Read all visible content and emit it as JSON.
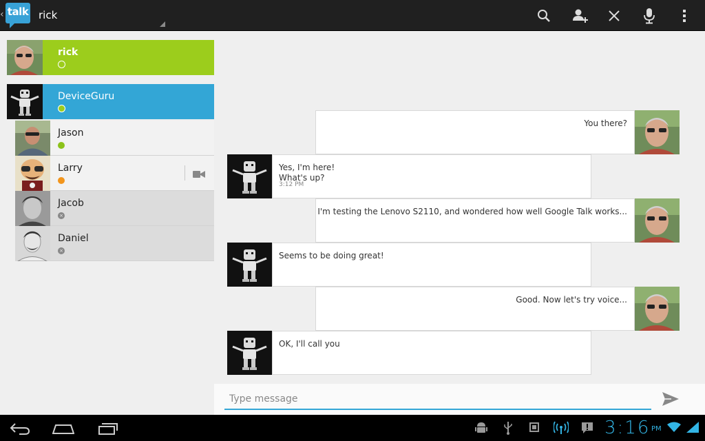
{
  "app": {
    "logo_text": "talk",
    "account": "rick"
  },
  "colors": {
    "accent_blue": "#33a6d6",
    "self_green": "#9ccd1c",
    "clock_blue": "#33b5e5"
  },
  "actionbar": {
    "icons": [
      "search-icon",
      "add-contact-icon",
      "close-icon",
      "microphone-icon",
      "overflow-menu-icon"
    ]
  },
  "me": {
    "name": "rick"
  },
  "active_contact": {
    "name": "DeviceGuru"
  },
  "contacts": [
    {
      "name": "Jason",
      "status": "available"
    },
    {
      "name": "Larry",
      "status": "idle"
    },
    {
      "name": "Jacob",
      "status": "offline"
    },
    {
      "name": "Daniel",
      "status": "offline"
    }
  ],
  "messages": [
    {
      "from": "me",
      "text": "You there?"
    },
    {
      "from": "DeviceGuru",
      "text": "Yes, I'm here!\nWhat's up?",
      "time": "3:12 PM"
    },
    {
      "from": "me",
      "text": "I'm testing the  Lenovo S2110, and wondered how well Google Talk works..."
    },
    {
      "from": "DeviceGuru",
      "text": "Seems to be doing great!"
    },
    {
      "from": "me",
      "text": "Good. Now let's try voice..."
    },
    {
      "from": "DeviceGuru",
      "text": "OK, I'll call you"
    }
  ],
  "compose": {
    "placeholder": "Type message"
  },
  "systembar": {
    "time": "3:16",
    "ampm": "PM"
  }
}
